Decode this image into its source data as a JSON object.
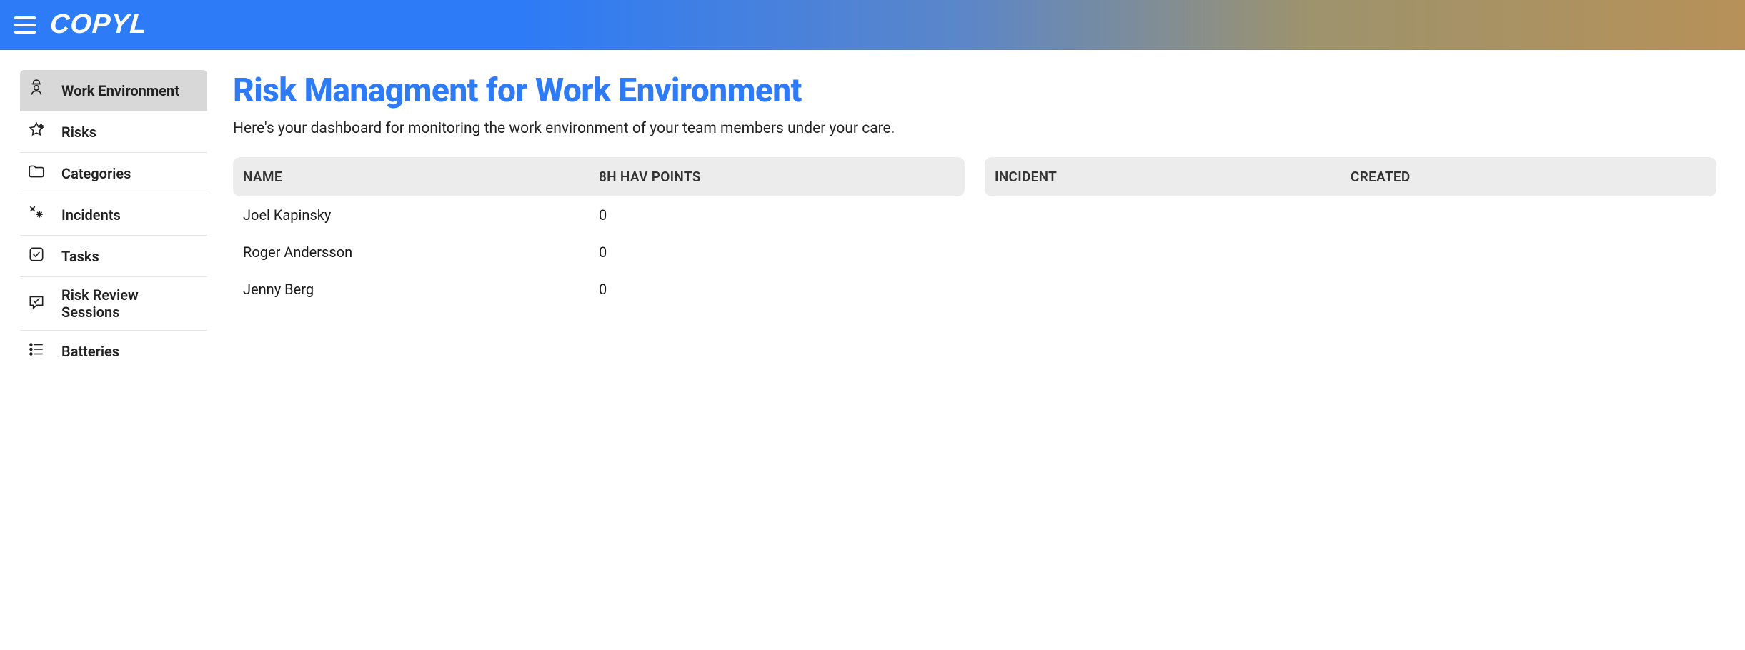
{
  "brand": {
    "name": "COPYL"
  },
  "sidebar": {
    "items": [
      {
        "label": "Work Environment",
        "icon": "worker-icon",
        "active": true
      },
      {
        "label": "Risks",
        "icon": "star-icon",
        "active": false
      },
      {
        "label": "Categories",
        "icon": "folder-icon",
        "active": false
      },
      {
        "label": "Incidents",
        "icon": "fireworks-icon",
        "active": false
      },
      {
        "label": "Tasks",
        "icon": "checkbox-icon",
        "active": false
      },
      {
        "label": "Risk Review Sessions",
        "icon": "speech-check-icon",
        "active": false
      },
      {
        "label": "Batteries",
        "icon": "list-icon",
        "active": false
      }
    ]
  },
  "page": {
    "title": "Risk Managment for Work Environment",
    "subtitle": "Here's your dashboard for monitoring the work environment of your team members under your care."
  },
  "hav_table": {
    "headers": [
      "NAME",
      "8H HAV POINTS"
    ],
    "rows": [
      {
        "name": "Joel Kapinsky",
        "points": "0"
      },
      {
        "name": "Roger Andersson",
        "points": "0"
      },
      {
        "name": "Jenny Berg",
        "points": "0"
      }
    ]
  },
  "incident_table": {
    "headers": [
      "INCIDENT",
      "CREATED"
    ],
    "rows": []
  }
}
